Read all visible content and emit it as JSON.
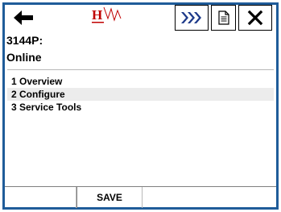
{
  "toolbar": {
    "back_icon": "back-arrow-icon",
    "logo_icon": "hart-logo-icon",
    "more_icon": "fast-forward-icon",
    "doc_icon": "document-icon",
    "close_icon": "close-icon"
  },
  "header": {
    "device_tag": "3144P:",
    "status": "Online"
  },
  "menu": {
    "items": [
      {
        "label": "1 Overview"
      },
      {
        "label": "2 Configure"
      },
      {
        "label": "3 Service Tools"
      }
    ],
    "selected_index": 1
  },
  "bottom": {
    "save_label": "SAVE"
  },
  "colors": {
    "frame": "#1f5c99",
    "selection": "#ececec",
    "more_arrows": "#1e3a8a",
    "logo": "#c00000"
  }
}
